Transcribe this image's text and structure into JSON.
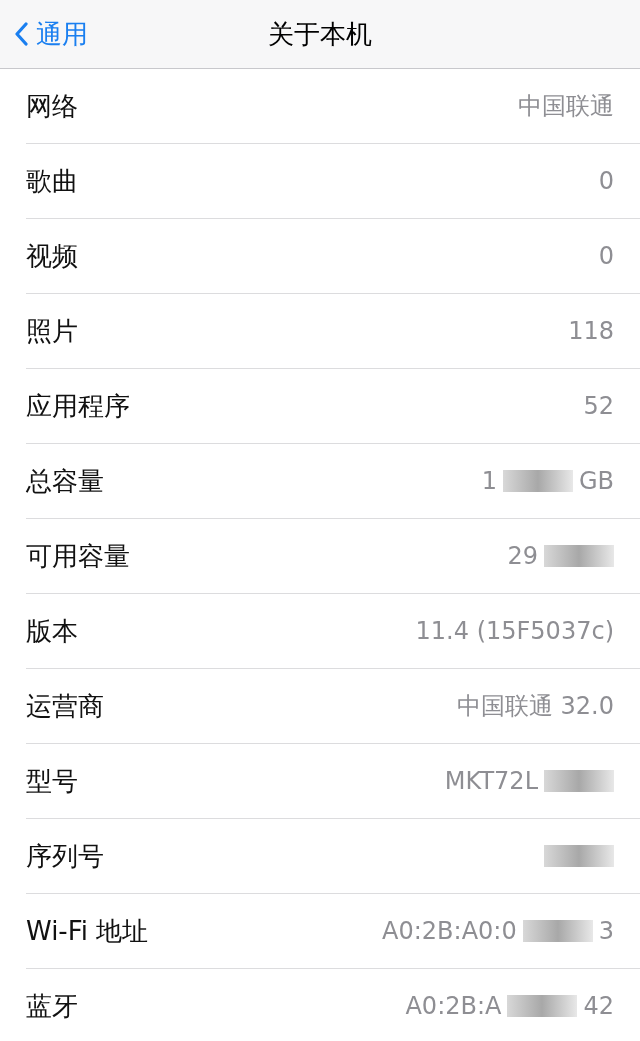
{
  "nav_bar": {
    "back_label": "通用",
    "title": "关于本机"
  },
  "rows": [
    {
      "label": "网络",
      "value_parts": [
        "中国联通"
      ]
    },
    {
      "label": "歌曲",
      "value_parts": [
        "0"
      ]
    },
    {
      "label": "视频",
      "value_parts": [
        "0"
      ]
    },
    {
      "label": "照片",
      "value_parts": [
        "118"
      ]
    },
    {
      "label": "应用程序",
      "value_parts": [
        "52"
      ]
    },
    {
      "label": "总容量",
      "value_parts": [
        "1",
        "GB"
      ],
      "redacted": true
    },
    {
      "label": "可用容量",
      "value_parts": [
        "29"
      ],
      "redacted": true
    },
    {
      "label": "版本",
      "value_parts": [
        "11.4 (15F5037c)"
      ]
    },
    {
      "label": "运营商",
      "value_parts": [
        "中国联通 32.0"
      ]
    },
    {
      "label": "型号",
      "value_parts": [
        "MKT72L"
      ],
      "redacted": true
    },
    {
      "label": "序列号",
      "value_parts": [],
      "redacted": true
    },
    {
      "label": "Wi-Fi 地址",
      "value_parts": [
        "A0:2B:A0:0",
        "3"
      ],
      "redacted": true
    },
    {
      "label": "蓝牙",
      "value_parts": [
        "A0:2B:A",
        "42"
      ],
      "redacted": true
    }
  ]
}
